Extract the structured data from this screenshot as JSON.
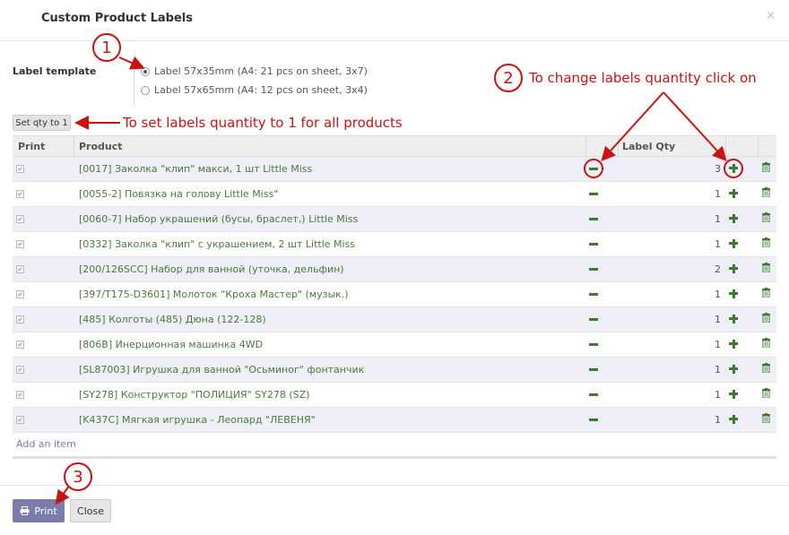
{
  "dialog": {
    "title": "Custom Product Labels",
    "close_symbol": "×"
  },
  "template": {
    "label": "Label template",
    "options": [
      {
        "text": "Label 57x35mm (A4: 21 pcs on sheet, 3x7)",
        "selected": true
      },
      {
        "text": "Label 57x65mm (A4: 12 pcs on sheet, 3x4)",
        "selected": false
      }
    ]
  },
  "set_qty_button": "Set qty to 1",
  "table": {
    "headers": {
      "print": "Print",
      "product": "Product",
      "qty": "Label Qty"
    },
    "rows": [
      {
        "print": true,
        "product": "[0017] Заколка \"клип\" макси, 1 шт Little Miss",
        "qty": "3"
      },
      {
        "print": true,
        "product": "[0055-2] Повязка на голову Little Miss\"",
        "qty": "1"
      },
      {
        "print": true,
        "product": "[0060-7] Набор украшений (бусы, браслет,) Little Miss",
        "qty": "1"
      },
      {
        "print": true,
        "product": "[0332] Заколка \"клип\" с украшением, 2 шт Little Miss",
        "qty": "1"
      },
      {
        "print": true,
        "product": "[200/126SCC] Набор для ванной (уточка, дельфин)",
        "qty": "2"
      },
      {
        "print": true,
        "product": "[397/T175-D3601] Молоток \"Кроха Мастер\" (музык.)",
        "qty": "1"
      },
      {
        "print": true,
        "product": "[485] Колготы (485) Дюна (122-128)",
        "qty": "1"
      },
      {
        "print": true,
        "product": "[806B] Инерционная машинка 4WD",
        "qty": "1"
      },
      {
        "print": true,
        "product": "[SL87003] Игрушка для ванной \"Осьминог\" фонтанчик",
        "qty": "1"
      },
      {
        "print": true,
        "product": "[SY278] Конструктор \"ПОЛИЦИЯ\" SY278 (SZ)",
        "qty": "1"
      },
      {
        "print": true,
        "product": "[K437C] Мягкая игрушка - Леопард \"ЛЕВЕНЯ\"",
        "qty": "1"
      }
    ],
    "add_item": "Add an item"
  },
  "footer": {
    "print_label": "Print",
    "close_label": "Close"
  },
  "annotations": {
    "circle1": "1",
    "circle2": "2",
    "circle3": "3",
    "text_qty_change": "To change labels quantity click on",
    "text_set_qty": "To set labels quantity to 1 for all products",
    "color": "#cc1111"
  },
  "colors": {
    "product_link": "#4b7a3a",
    "primary_button": "#7c7bad",
    "row_odd": "#eeeef6"
  }
}
